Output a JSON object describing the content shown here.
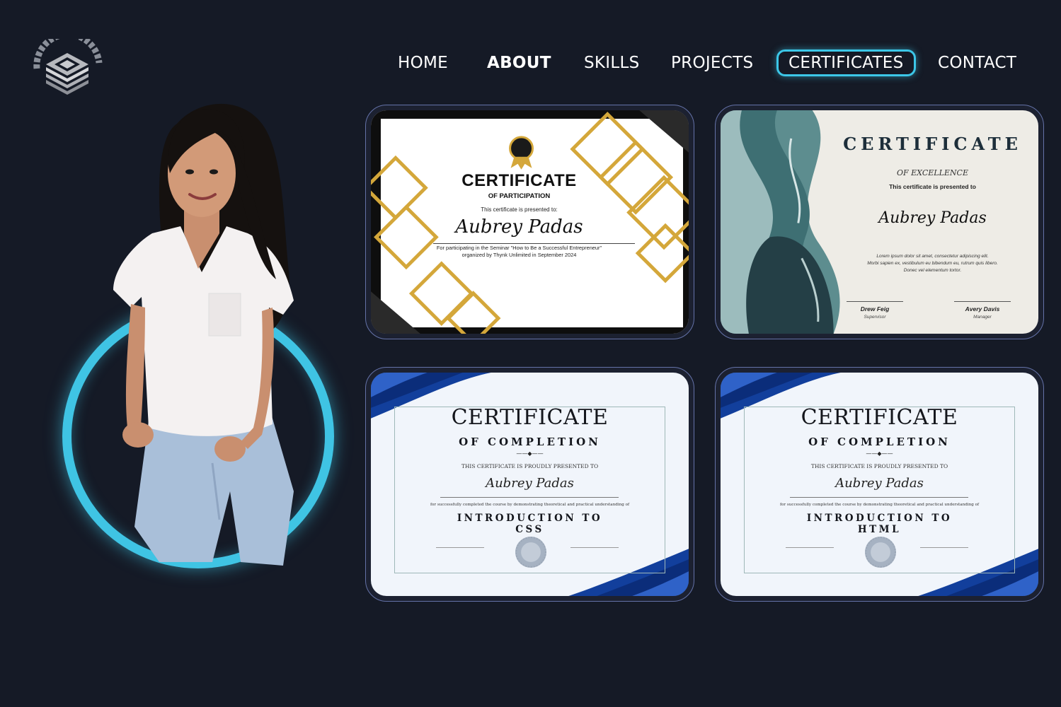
{
  "logo": {
    "alt": "Architects logo"
  },
  "nav": {
    "items": [
      {
        "label": "HOME"
      },
      {
        "label": "ABOUT"
      },
      {
        "label": "SKILLS"
      },
      {
        "label": "PROJECTS"
      },
      {
        "label": "CERTIFICATES"
      },
      {
        "label": "CONTACT"
      }
    ],
    "active": "CERTIFICATES"
  },
  "colors": {
    "background": "#151a26",
    "accent": "#3fc4e4",
    "card_border": "#6472a8"
  },
  "certificates": [
    {
      "title": "CERTIFICATE",
      "subtitle": "OF PARTICIPATION",
      "presented": "This certificate is presented to:",
      "name": "Aubrey Padas",
      "description_1": "For participating in the Seminar \"How to Be a Successful Entrepreneur\"",
      "description_2": "organized by Thynk Unlimited in September 2024"
    },
    {
      "title": "CERTIFICATE",
      "subtitle": "OF EXCELLENCE",
      "presented": "This certificate is presented to",
      "name": "Aubrey Padas",
      "description_1": "Lorem ipsum dolor sit amet, consectetur adipiscing elit.",
      "description_2": "Morbi sapien ex, vestibulum eu bibendum eu, rutrum quis libero.",
      "description_3": "Donec vel elementum tortor.",
      "signer_1": {
        "name": "Drew Feig",
        "role": "Supervisor"
      },
      "signer_2": {
        "name": "Avery Davis",
        "role": "Manager"
      }
    },
    {
      "title": "CERTIFICATE",
      "subtitle": "OF COMPLETION",
      "presented": "THIS CERTIFICATE IS PROUDLY PRESENTED TO",
      "name": "Aubrey Padas",
      "description": "for successfully completed the course by demonstrating theoretical and practical understanding of",
      "course": "INTRODUCTION TO CSS"
    },
    {
      "title": "CERTIFICATE",
      "subtitle": "OF COMPLETION",
      "presented": "THIS CERTIFICATE IS PROUDLY PRESENTED TO",
      "name": "Aubrey Padas",
      "description": "for successfully completed the course by demonstrating theoretical and practical understanding of",
      "course": "INTRODUCTION TO HTML"
    }
  ]
}
